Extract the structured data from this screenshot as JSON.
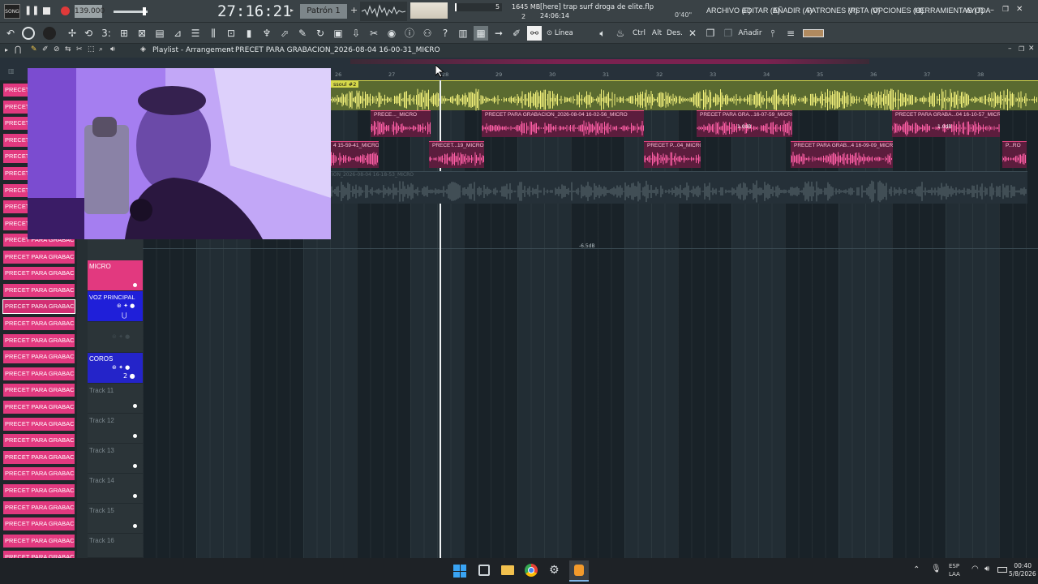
{
  "topbar": {
    "song_label": "SONG",
    "tempo": "139.000",
    "time": "27:16:21",
    "pattern": "Patrón 1",
    "cpu_value": "5",
    "memory": "1645 MB",
    "voices": "2",
    "hint_title": "[here] trap surf droga de elite.flp",
    "hint_time": "24:06:14",
    "offset": "0'40\"",
    "menu": [
      "ARCHIVO (F)",
      "EDITAR (E)",
      "AÑADIR (A)",
      "PATRONES (P)",
      "VISTA (V)",
      "OPCIONES (O)",
      "HERRAMIENTAS (T)",
      "AYUDA"
    ]
  },
  "toolbar": {
    "mode": "Línea",
    "ctrl": "Ctrl",
    "alt": "Alt",
    "des": "Des.",
    "add": "Añadir"
  },
  "playlist": {
    "title": "Playlist - Arrangement",
    "breadcrumb": "PRECET PARA GRABACION_2026-08-04 16-00-31_MICRO",
    "ruler_numbers": [
      "26",
      "27",
      "28",
      "29",
      "30",
      "31",
      "32",
      "33",
      "34",
      "35",
      "36",
      "37",
      "38"
    ],
    "top_clip_label": "ssoul #2",
    "auto_label": "-6.5dB"
  },
  "picker": {
    "items_short": [
      "PRECET PI",
      "PRECET PI",
      "PRECET PI",
      "PRECET PI",
      "PRECET PI",
      "PRECET PI",
      "PRECET PI",
      "PRECET PI",
      "PRECET PI"
    ],
    "items": [
      "PRECET PARA GRABACION...",
      "PRECET PARA GRABACION...",
      "PRECET PARA GRABACION...",
      "PRECET PARA GRABACION...",
      "PRECET PARA GRABACION...",
      "PRECET PARA GRABACION...",
      "PRECET PARA GRABACION...",
      "PRECET PARA GRABACION...",
      "PRECET PARA GRABACION...",
      "PRECET PARA GRABACION...",
      "PRECET PARA GRABACION...",
      "PRECET PARA GRABACION...",
      "PRECET PARA GRABACION...",
      "PRECET PARA GRABACION...",
      "PRECET PARA GRABACION...",
      "PRECET PARA GRABACION...",
      "PRECET PARA GRABACION...",
      "PRECET PARA GRABACION...",
      "PRECET PARA GRABACION...",
      "PRECET PARA GRABACION..."
    ]
  },
  "tracks": {
    "micro": "MICRO",
    "voz": "VOZ PRINCIPAL",
    "coros": "COROS",
    "t11": "Track 11",
    "t12": "Track 12",
    "t13": "Track 13",
    "t14": "Track 14",
    "t15": "Track 15",
    "t16": "Track 16"
  },
  "clips": {
    "row1": [
      "PRECE..._MICRO",
      "PRECET PARA GRABACION_2026-08-04 16-02-56_MICRO",
      "PRECET PARA GRA...16-07-59_MICRO",
      "PRECET PARA GRABA...04 16-10-57_MICRO"
    ],
    "row2": [
      "4 15-59-41_MICRO",
      "PRECET...19_MICRO",
      "PRECET P...04_MICRO",
      "PRECET PARA GRAB...4 16-09-09_MICRO",
      "P...RO"
    ],
    "gain": "1.0dB",
    "row3": "ION_2026-08-04 16-18-53_MICRO"
  },
  "taskbar": {
    "lang": "ESP",
    "lang2": "LAA",
    "clock": "00:40",
    "date": "5/8/2026"
  }
}
